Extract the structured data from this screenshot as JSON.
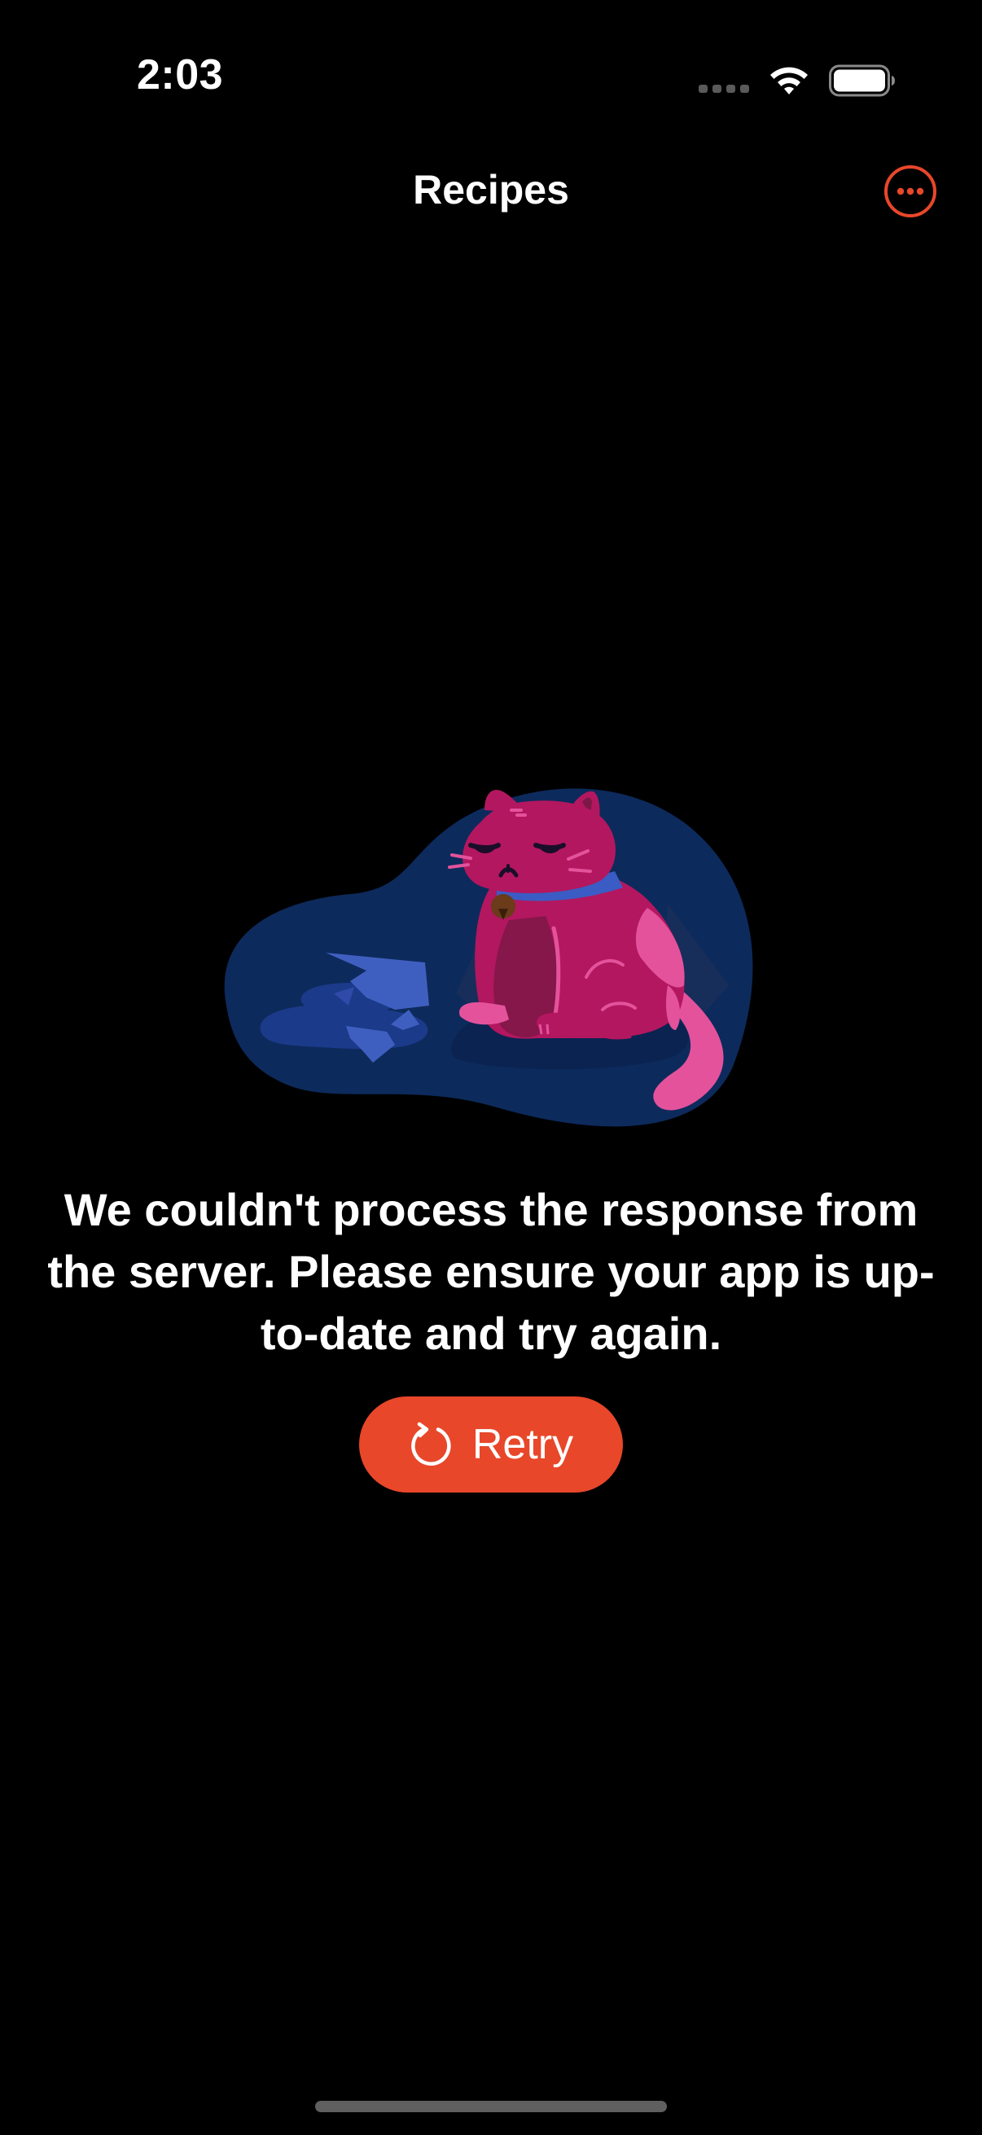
{
  "status_bar": {
    "time": "2:03"
  },
  "nav": {
    "title": "Recipes",
    "more_icon": "ellipsis-circle-icon"
  },
  "illustration": {
    "icon": "sad-cat-broken-vase-illustration"
  },
  "error": {
    "message": "We couldn't process the response from the server. Please ensure your app is up-to-date and try again."
  },
  "retry": {
    "label": "Retry",
    "icon": "arrow-clockwise-icon"
  },
  "colors": {
    "background": "#000000",
    "accent": "#e8472a",
    "text": "#ffffff",
    "blob": "#0d2a5c",
    "cat_body": "#b3175f",
    "cat_highlight": "#e4529c",
    "collar": "#3b5cc4"
  }
}
